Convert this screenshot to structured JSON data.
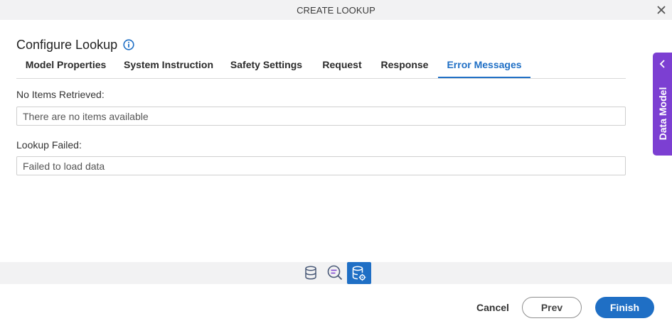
{
  "dialog": {
    "title": "CREATE LOOKUP",
    "close_icon": "close-icon"
  },
  "heading": {
    "text": "Configure Lookup",
    "info_icon": "info-icon"
  },
  "tabs": [
    {
      "label": "Model Properties",
      "active": false
    },
    {
      "label": "System Instruction",
      "active": false
    },
    {
      "label": "Safety Settings",
      "active": false
    },
    {
      "label": "Request",
      "active": false
    },
    {
      "label": "Response",
      "active": false
    },
    {
      "label": "Error Messages",
      "active": true
    }
  ],
  "fields": {
    "no_items": {
      "label": "No Items Retrieved:",
      "value": "There are no items available"
    },
    "lookup_failed": {
      "label": "Lookup Failed:",
      "value": "Failed to load data"
    }
  },
  "side_panel": {
    "label": "Data Model",
    "icon": "chevron-left-icon"
  },
  "icon_bar": [
    {
      "icon": "database-icon",
      "active": false
    },
    {
      "icon": "search-lines-icon",
      "active": false
    },
    {
      "icon": "database-settings-icon",
      "active": true
    }
  ],
  "footer": {
    "cancel": "Cancel",
    "prev": "Prev",
    "finish": "Finish"
  },
  "colors": {
    "accent": "#1f6fc5",
    "side_panel": "#7c3fd2",
    "bar_bg": "#f2f2f3"
  }
}
